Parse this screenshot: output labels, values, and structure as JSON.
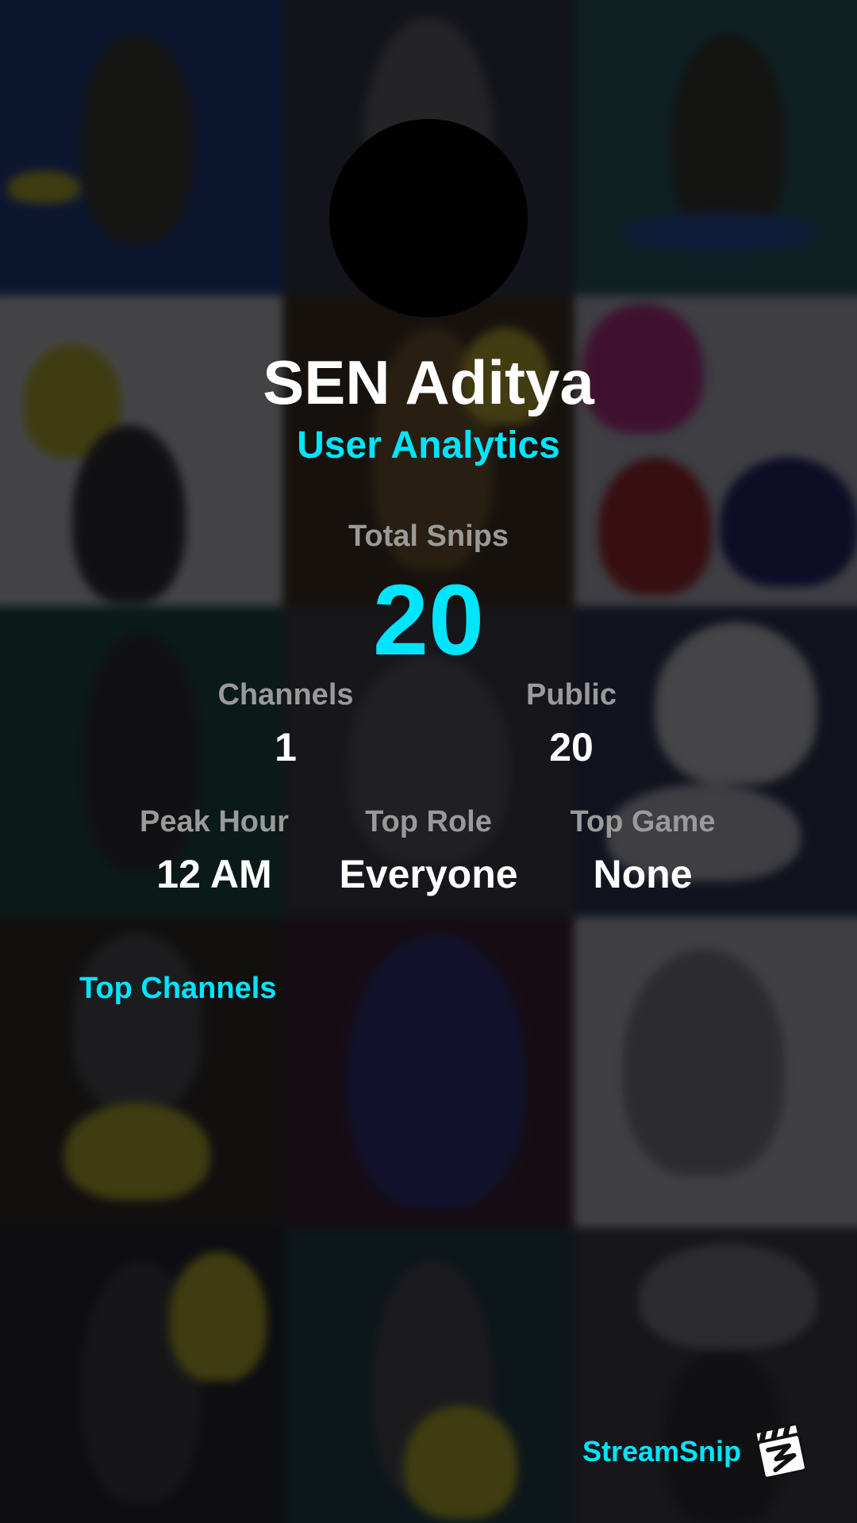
{
  "profile": {
    "username": "SEN Aditya",
    "subtitle": "User Analytics"
  },
  "stats": {
    "total_snips": {
      "label": "Total Snips",
      "value": "20"
    },
    "channels": {
      "label": "Channels",
      "value": "1"
    },
    "public": {
      "label": "Public",
      "value": "20"
    },
    "peak_hour": {
      "label": "Peak Hour",
      "value": "12 AM"
    },
    "top_role": {
      "label": "Top Role",
      "value": "Everyone"
    },
    "top_game": {
      "label": "Top Game",
      "value": "None"
    }
  },
  "sections": {
    "top_channels": "Top Channels"
  },
  "brand": {
    "name": "StreamSnip",
    "logo_icon": "clapperboard-icon"
  },
  "colors": {
    "accent": "#00e5ff",
    "label_gray": "#9a9a9a",
    "text": "#ffffff",
    "avatar": "#000000"
  }
}
